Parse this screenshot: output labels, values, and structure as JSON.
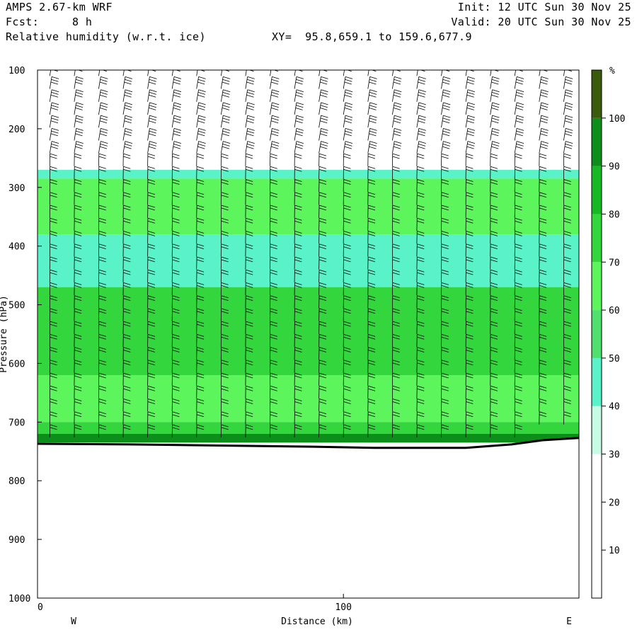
{
  "header": {
    "model": "AMPS 2.67-km WRF",
    "fcst_label": "Fcst:",
    "fcst_value": "8 h",
    "field": "Relative humidity (w.r.t. ice)",
    "xy": "XY=  95.8,659.1 to 159.6,677.9",
    "init": "Init: 12 UTC Sun 30 Nov 25",
    "valid": "Valid: 20 UTC Sun 30 Nov 25"
  },
  "chart_data": {
    "type": "heatmap",
    "title": "Relative humidity (w.r.t. ice)",
    "xlabel": "Distance (km)",
    "ylabel": "Pressure (hPa)",
    "xlim": [
      0,
      177
    ],
    "ylim": [
      1000,
      100
    ],
    "x_ticks": [
      0,
      100
    ],
    "y_ticks": [
      100,
      200,
      300,
      400,
      500,
      600,
      700,
      800,
      900,
      1000
    ],
    "left_end_label": "W",
    "right_end_label": "E",
    "colorbar": {
      "unit": "%",
      "levels": [
        10,
        20,
        30,
        40,
        50,
        60,
        70,
        80,
        90,
        100
      ],
      "colors": [
        "#ffffff",
        "#ffffff",
        "#ffffff",
        "#c6fce4",
        "#5af2c8",
        "#4fe06e",
        "#5cf55c",
        "#33d63c",
        "#16b823",
        "#0b8f1a",
        "#3a5a0c"
      ]
    },
    "terrain_pressure_hPa": [
      {
        "x": 0,
        "p": 737
      },
      {
        "x": 30,
        "p": 738
      },
      {
        "x": 60,
        "p": 740
      },
      {
        "x": 90,
        "p": 742
      },
      {
        "x": 110,
        "p": 744
      },
      {
        "x": 140,
        "p": 744
      },
      {
        "x": 155,
        "p": 738
      },
      {
        "x": 165,
        "p": 731
      },
      {
        "x": 177,
        "p": 727
      }
    ],
    "rh_layers": [
      {
        "p_top": 100,
        "p_bottom": 270,
        "rh": 20
      },
      {
        "p_top": 270,
        "p_bottom": 285,
        "rh": 45
      },
      {
        "p_top": 285,
        "p_bottom": 380,
        "rh": 65
      },
      {
        "p_top": 380,
        "p_bottom": 470,
        "rh": 48
      },
      {
        "p_top": 470,
        "p_bottom": 620,
        "rh": 72
      },
      {
        "p_top": 620,
        "p_bottom": 700,
        "rh": 66
      },
      {
        "p_top": 700,
        "p_bottom": 720,
        "rh": 78
      },
      {
        "p_top": 720,
        "p_bottom": 735,
        "rh": 92
      }
    ],
    "wind_barb_columns_km": [
      4,
      12,
      20,
      28,
      36,
      44,
      52,
      60,
      68,
      76,
      84,
      92,
      100,
      108,
      116,
      124,
      132,
      140,
      148,
      156,
      164,
      172
    ]
  }
}
